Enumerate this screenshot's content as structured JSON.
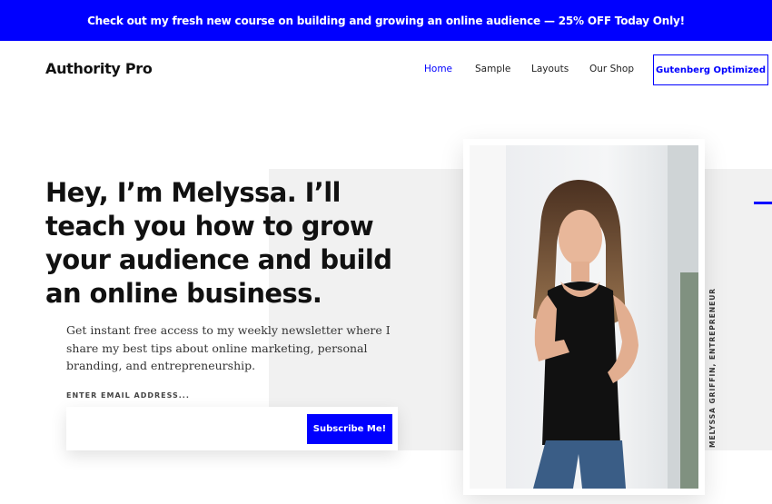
{
  "promo": {
    "text": "Check out my fresh new course on building and growing an online audience — 25% OFF Today Only!"
  },
  "header": {
    "site_title": "Authority Pro",
    "nav": [
      {
        "label": "Home",
        "active": true
      },
      {
        "label": "Sample"
      },
      {
        "label": "Layouts"
      },
      {
        "label": "Our Shop"
      }
    ],
    "cta_label": "Gutenberg Optimized"
  },
  "hero": {
    "headline": "Hey, I’m Melyssa. I’ll teach you how to grow your audience and build an online business.",
    "intro": "Get instant free access to my weekly newsletter where I share my best tips about online marketing, personal branding, and entrepreneurship.",
    "email_label": "ENTER EMAIL ADDRESS...",
    "email_value": "",
    "subscribe_label": "Subscribe Me!",
    "photo_caption": "MELYSSA GRIFFIN, ENTREPRENEUR"
  },
  "colors": {
    "accent": "#0000ff",
    "panel": "#f1f1f1",
    "text": "#111111"
  }
}
